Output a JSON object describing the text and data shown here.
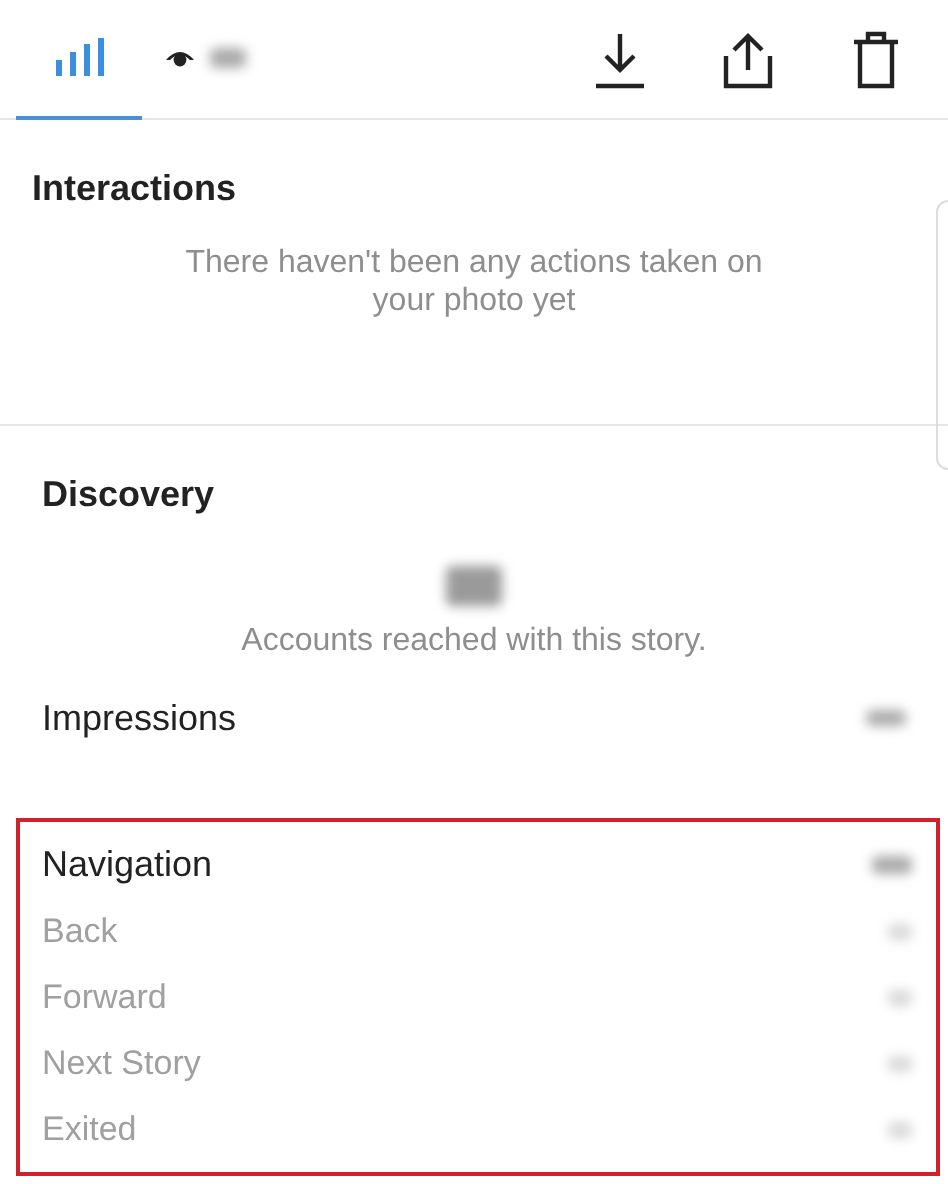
{
  "tabs": [
    {
      "kind": "stats",
      "selected": true
    },
    {
      "kind": "views",
      "selected": false
    }
  ],
  "toolbar": [
    {
      "kind": "download"
    },
    {
      "kind": "share"
    },
    {
      "kind": "delete"
    }
  ],
  "interactions": {
    "title": "Interactions",
    "message": "There haven't been any actions taken on your photo yet"
  },
  "discovery": {
    "title": "Discovery",
    "reach_label": "Accounts reached with this story.",
    "impressions_label": "Impressions"
  },
  "navigation": {
    "highlighted": true,
    "title": "Navigation",
    "rows": [
      {
        "label": "Back"
      },
      {
        "label": "Forward"
      },
      {
        "label": "Next Story"
      },
      {
        "label": "Exited"
      }
    ]
  }
}
